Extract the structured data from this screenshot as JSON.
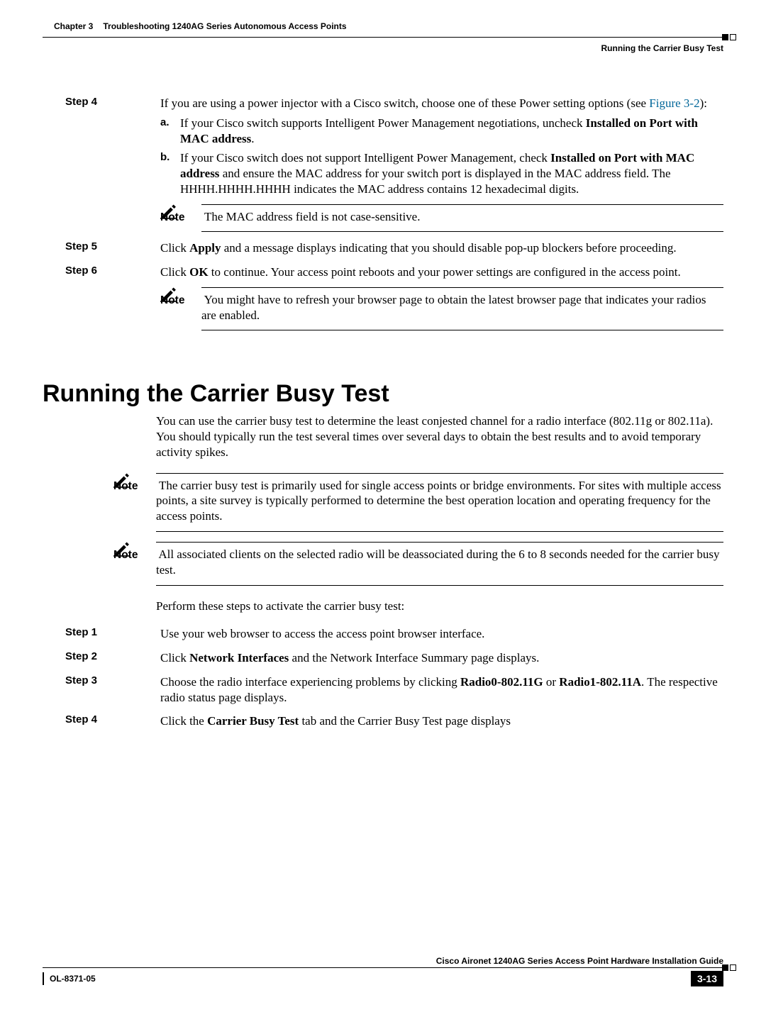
{
  "header": {
    "chapter_label": "Chapter 3",
    "chapter_title": "Troubleshooting 1240AG Series Autonomous Access Points",
    "section_running": "Running the Carrier Busy Test"
  },
  "steps_top": {
    "s4": {
      "label": "Step 4",
      "text_pre": "If you are using a power injector with a Cisco switch, choose one of these Power setting options (see ",
      "figure_ref": "Figure 3-2",
      "text_post": "):",
      "a": {
        "label": "a.",
        "pre": "If your Cisco switch supports Intelligent Power Management negotiations, uncheck ",
        "bold": "Installed on Port with MAC address",
        "post": "."
      },
      "b": {
        "label": "b.",
        "pre": "If your Cisco switch does not support Intelligent Power Management, check ",
        "bold": "Installed on Port with MAC address",
        "post": " and ensure the MAC address for your switch port is displayed in the MAC address field. The HHHH.HHHH.HHHH indicates the MAC address contains 12 hexadecimal digits."
      },
      "note": {
        "label": "Note",
        "text": "The MAC address field is not case-sensitive."
      }
    },
    "s5": {
      "label": "Step 5",
      "pre": "Click ",
      "bold": "Apply",
      "post": " and a message displays indicating that you should disable pop-up blockers before proceeding."
    },
    "s6": {
      "label": "Step 6",
      "pre": "Click ",
      "bold": "OK",
      "post": " to continue. Your access point reboots and your power settings are configured in the access point.",
      "note": {
        "label": "Note",
        "text": "You might have to refresh your browser page to obtain the latest browser page that indicates your radios are enabled."
      }
    }
  },
  "section": {
    "heading": "Running the Carrier Busy Test",
    "intro": "You can use the carrier busy test to determine the least conjested channel for a radio interface (802.11g or 802.11a). You should typically run the test several times over several days to obtain the best results and to avoid temporary activity spikes.",
    "note1": {
      "label": "Note",
      "text": "The carrier busy test is primarily used for single access points or bridge environments. For sites with multiple access points, a site survey is typically performed to determine the best operation location and operating frequency for the access points."
    },
    "note2": {
      "label": "Note",
      "text": "All associated clients on the selected radio will be deassociated during the 6 to 8 seconds needed for the carrier busy test."
    },
    "perform": "Perform these steps to activate the carrier busy test:",
    "steps": {
      "s1": {
        "label": "Step 1",
        "text": "Use your web browser to access the access point browser interface."
      },
      "s2": {
        "label": "Step 2",
        "pre": "Click ",
        "bold": "Network Interfaces",
        "post": " and the Network Interface Summary page displays."
      },
      "s3": {
        "label": "Step 3",
        "pre": "Choose the radio interface experiencing problems by clicking ",
        "b1": "Radio0-802.11G",
        "mid": " or ",
        "b2": "Radio1-802.11A",
        "post": ". The respective radio status page displays."
      },
      "s4": {
        "label": "Step 4",
        "pre": "Click the ",
        "bold": "Carrier Busy Test",
        "post": " tab and the Carrier Busy Test page displays"
      }
    }
  },
  "footer": {
    "doc_title": "Cisco Aironet 1240AG Series Access Point Hardware Installation Guide",
    "ol": "OL-8371-05",
    "page": "3-13"
  }
}
